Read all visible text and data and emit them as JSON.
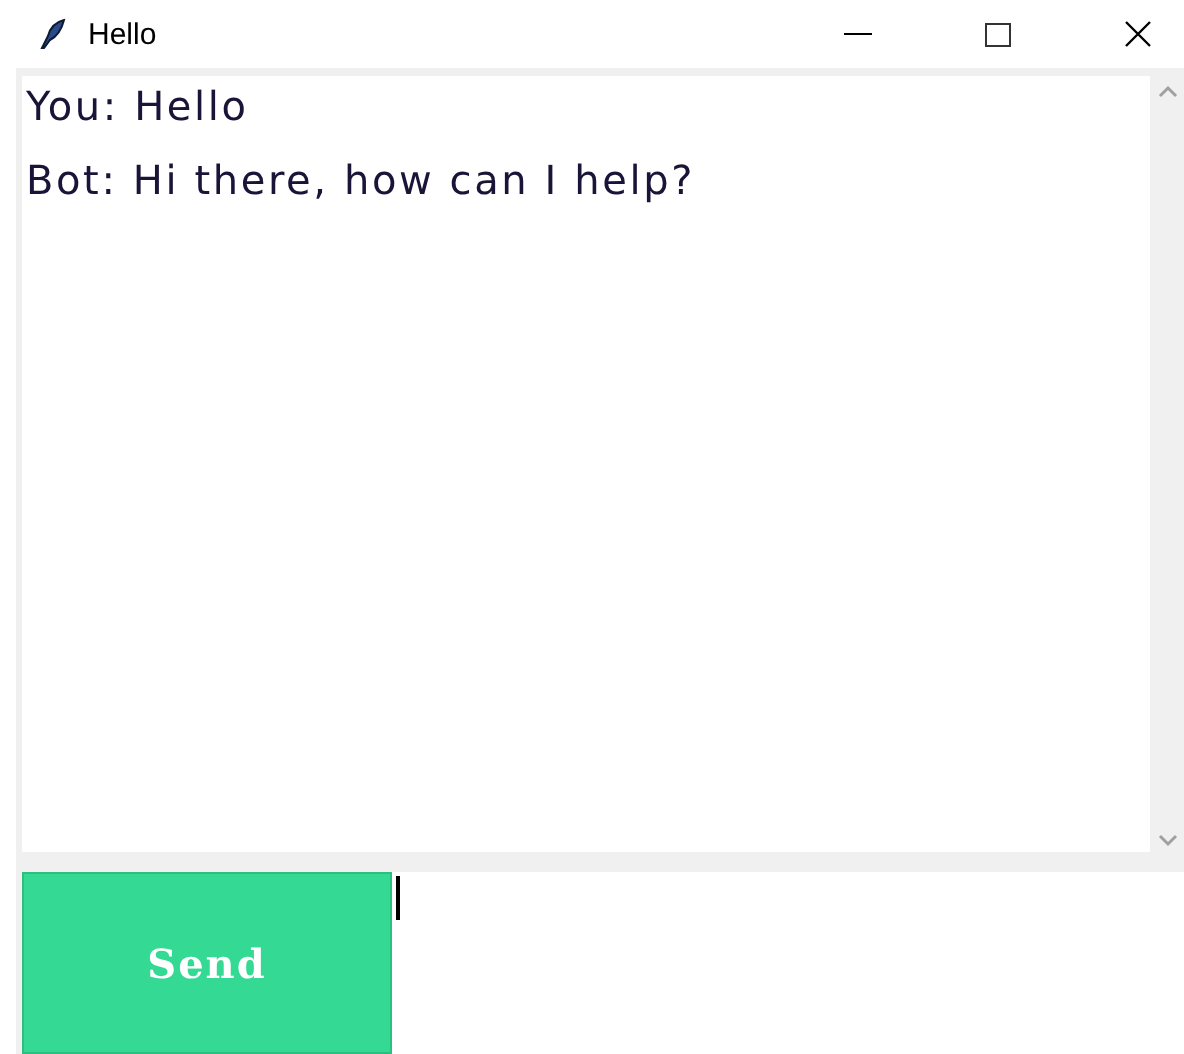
{
  "window": {
    "title": "Hello"
  },
  "chat_log": {
    "messages": [
      {
        "text": "You: Hello"
      },
      {
        "text": "Bot: Hi there, how can I help?"
      }
    ]
  },
  "send_button": {
    "label": "Send"
  }
}
